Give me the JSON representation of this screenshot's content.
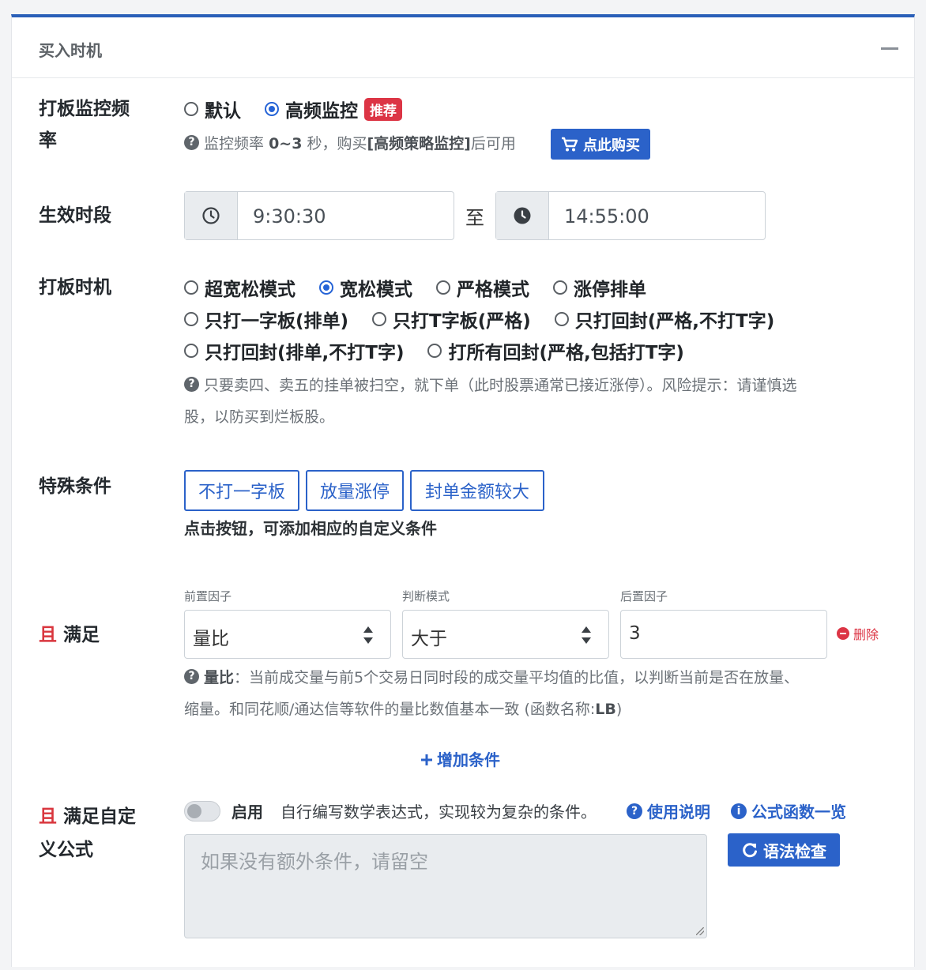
{
  "panel": {
    "title": "买入时机"
  },
  "freq": {
    "label": "打板监控频率",
    "options": [
      "默认",
      "高频监控"
    ],
    "badge": "推荐",
    "help_prefix": "监控频率",
    "help_bold": "0~3",
    "help_mid": "秒，购买",
    "help_bold2": "[高频策略监控]",
    "help_suffix": "后可用",
    "buy_label": "点此购买"
  },
  "period": {
    "label": "生效时段",
    "start": "9:30:30",
    "to": "至",
    "end": "14:55:00"
  },
  "timing": {
    "label": "打板时机",
    "row1": [
      "超宽松模式",
      "宽松模式",
      "严格模式",
      "涨停排单"
    ],
    "row2": [
      "只打一字板(排单)",
      "只打T字板(严格)",
      "只打回封(严格,不打T字)"
    ],
    "row3": [
      "只打回封(排单,不打T字)",
      "打所有回封(严格,包括打T字)"
    ],
    "help_line1": "只要卖四、卖五的挂单被扫空，就下单（此时股票通常已接近涨停）。风险提示：请谨慎选",
    "help_line2": "股，以防买到烂板股。"
  },
  "special": {
    "label": "特殊条件",
    "buttons": [
      "不打一字板",
      "放量涨停",
      "封单金额较大"
    ],
    "hint": "点击按钮，可添加相应的自定义条件"
  },
  "condition": {
    "label_red": "且",
    "label": "满足",
    "front_label": "前置因子",
    "front_value": "量比",
    "mode_label": "判断模式",
    "mode_value": "大于",
    "back_label": "后置因子",
    "back_value": "3",
    "delete_label": "删除",
    "help_bold": "量比",
    "help_line1": "：当前成交量与前5个交易日同时段的成交量平均值的比值，以判断当前是否在放量、",
    "help_line2": "缩量。和同花顺/通达信等软件的量比数值基本一致 (函数名称:",
    "help_code": "LB",
    "help_close": ")",
    "add_label": "增加条件"
  },
  "custom": {
    "label_red": "且",
    "label_line1": "满足自定",
    "label_line2": "义公式",
    "enable_label": "启用",
    "desc": "自行编写数学表达式，实现较为复杂的条件。",
    "link_usage": "使用说明",
    "link_functions": "公式函数一览",
    "placeholder": "如果没有额外条件，请留空",
    "check_label": "语法检查"
  },
  "colors": {
    "primary": "#2b62c9",
    "danger": "#dc3545",
    "top_border": "#2a5fb8"
  }
}
